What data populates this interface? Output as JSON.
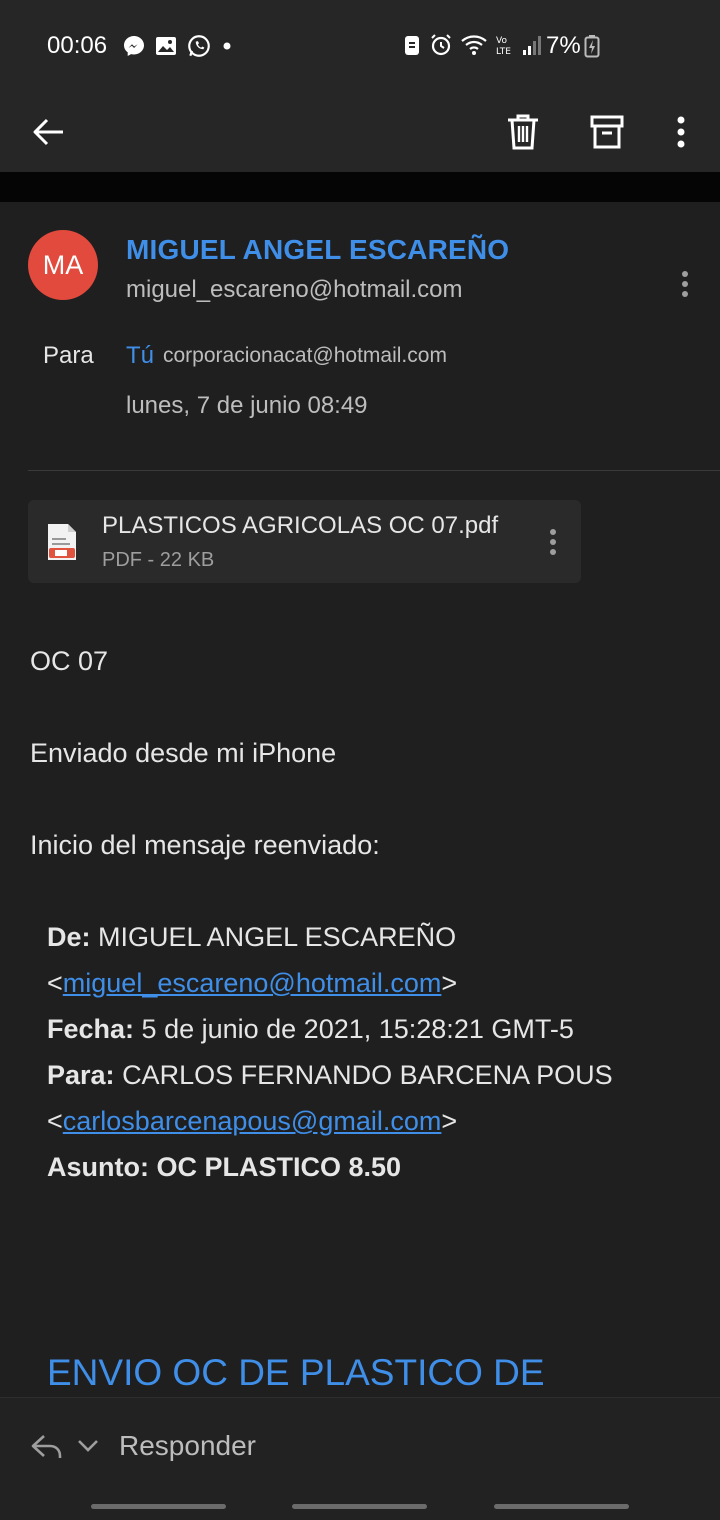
{
  "status_bar": {
    "time": "00:06",
    "battery": "7%"
  },
  "toolbar": {
    "back_icon": "arrow-left-icon",
    "delete_icon": "trash-icon",
    "archive_icon": "archive-icon",
    "more_icon": "more-vertical-icon"
  },
  "email": {
    "avatar_initials": "MA",
    "avatar_color": "#e14a3c",
    "sender_name": "MIGUEL ANGEL ESCAREÑO",
    "sender_email": "miguel_escareno@hotmail.com",
    "to_label": "Para",
    "to_name": "Tú",
    "to_email": "corporacionacat@hotmail.com",
    "date": "lunes, 7 de junio 08:49",
    "attachment": {
      "name": "PLASTICOS AGRICOLAS OC 07.pdf",
      "meta": "PDF - 22 KB"
    },
    "body": {
      "line1": "OC 07",
      "line2": "Enviado desde mi iPhone",
      "line3": "Inicio del mensaje reenviado:",
      "from_label": "De:",
      "from_name": "MIGUEL ANGEL ESCAREÑO",
      "from_email": "miguel_escareno@hotmail.com",
      "date_label": "Fecha:",
      "date_value": "5 de junio de 2021, 15:28:21 GMT-5",
      "to_label": "Para:",
      "to_name": "CARLOS FERNANDO BARCENA POUS",
      "to_email": "carlosbarcenapous@gmail.com",
      "subject_label": "Asunto:",
      "subject_value": "OC PLASTICO 8.50",
      "heading": "ENVIO OC DE PLASTICO DE"
    }
  },
  "bottom_bar": {
    "reply_label": "Responder"
  },
  "colors": {
    "accent": "#3f8ee8",
    "background": "#1f1f1f"
  }
}
